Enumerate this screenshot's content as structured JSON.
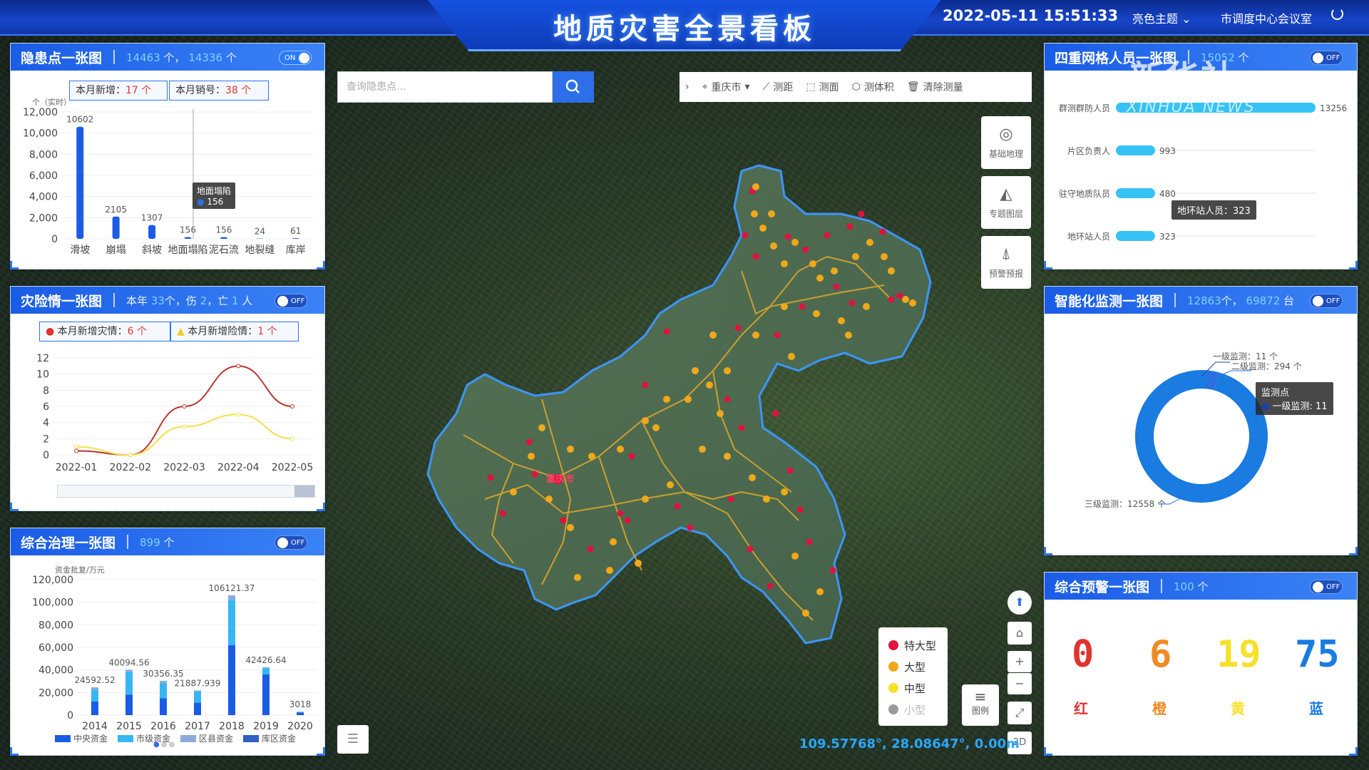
{
  "header": {
    "title": "地质灾害全景看板",
    "datetime": "2022-05-11 15:51:33",
    "theme_label": "亮色主题",
    "room_label": "市调度中心会议室"
  },
  "colors": {
    "primary": "#2e74f0",
    "red": "#e0332f",
    "orange": "#f08a24",
    "yellow": "#f5e12a",
    "blue": "#1a7be0"
  },
  "panel_hazard": {
    "title": "隐患点一张图",
    "stat_total": "14463",
    "unit1": "个，",
    "stat_active": "14336",
    "unit2": "个",
    "toggle": "ON",
    "chip_new_label": "本月新增：",
    "chip_new_value": "17 个",
    "chip_cancel_label": "本月销号：",
    "chip_cancel_value": "38 个",
    "y_unit": "个（实时）",
    "tooltip_title": "地面塌陷",
    "tooltip_value": "156"
  },
  "panel_disaster": {
    "title": "灾险情一张图",
    "stat_prefix": "本年",
    "stat_count": "33",
    "stat_mid": "个，伤",
    "stat_injured": "2",
    "stat_mid2": "，亡",
    "stat_dead": "1",
    "stat_suffix": "人",
    "toggle": "OFF",
    "chip_disaster_label": "本月新增灾情：",
    "chip_disaster_value": "6 个",
    "chip_risk_label": "本月新增险情：",
    "chip_risk_value": "1 个"
  },
  "panel_governance": {
    "title": "综合治理一张图",
    "stat": "899",
    "unit": "个",
    "toggle": "OFF",
    "y_unit": "资金批复/万元"
  },
  "panel_grid": {
    "title": "四重网格人员一张图",
    "stat": "15052",
    "unit": "个",
    "toggle": "OFF",
    "tooltip": "地环站人员：323"
  },
  "panel_monitor": {
    "title": "智能化监测一张图",
    "stat1": "12863",
    "unit1": "个，",
    "stat2": "69872",
    "unit2": "台",
    "toggle": "OFF",
    "tooltip_title": "监测点",
    "tooltip_line": "一级监测: 11"
  },
  "panel_warning": {
    "title": "综合预警一张图",
    "stat": "100",
    "unit": "个",
    "toggle": "OFF",
    "levels": [
      {
        "value": "0",
        "label": "红",
        "color": "#e0332f"
      },
      {
        "value": "6",
        "label": "橙",
        "color": "#f08a24"
      },
      {
        "value": "19",
        "label": "黄",
        "color": "#f5e12a"
      },
      {
        "value": "75",
        "label": "蓝",
        "color": "#1a7be0"
      }
    ]
  },
  "map": {
    "search_placeholder": "查询隐患点...",
    "city": "重庆市",
    "tools": [
      "测距",
      "测面",
      "测体积",
      "清除测量"
    ],
    "side_tools": [
      "基础地理",
      "专题图层",
      "预警预报"
    ],
    "legend": [
      {
        "label": "特大型",
        "color": "#e0123f"
      },
      {
        "label": "大型",
        "color": "#f0a81a"
      },
      {
        "label": "中型",
        "color": "#f5e12a"
      },
      {
        "label": "小型",
        "color": "#9a9a9a"
      }
    ],
    "legend_button": "图例",
    "coords": "109.57768°, 28.08647°, 0.00m",
    "mode_2d": "2D",
    "city_label": "重庆市"
  },
  "watermark": {
    "cn": "新华社",
    "en": "XINHUA NEWS"
  },
  "chart_data": [
    {
      "type": "bar",
      "title": "",
      "categories": [
        "滑坡",
        "崩塌",
        "斜坡",
        "地面塌陷",
        "泥石流",
        "地裂缝",
        "库岸"
      ],
      "values": [
        10602,
        2105,
        1307,
        156,
        156,
        24,
        61
      ],
      "ylim": [
        0,
        12000
      ],
      "yticks": [
        0,
        2000,
        4000,
        6000,
        8000,
        10000,
        12000
      ],
      "ylabel": "个（实时）"
    },
    {
      "type": "line",
      "title": "",
      "x": [
        "2022-01",
        "2022-02",
        "2022-03",
        "2022-04",
        "2022-05"
      ],
      "series": [
        {
          "name": "灾情",
          "color": "#c0322a",
          "values": [
            0.5,
            0,
            6,
            11,
            6
          ]
        },
        {
          "name": "险情",
          "color": "#f0e24a",
          "values": [
            1,
            0,
            3.5,
            5,
            2
          ]
        }
      ],
      "ylim": [
        0,
        12
      ],
      "yticks": [
        0,
        2,
        4,
        6,
        8,
        10,
        12
      ]
    },
    {
      "type": "bar",
      "title": "",
      "categories": [
        "2014",
        "2015",
        "2016",
        "2017",
        "2018",
        "2019",
        "2020"
      ],
      "totals": [
        24592.52,
        40094.56,
        30356.35,
        21887.939,
        106121.37,
        42426.64,
        3018
      ],
      "series": [
        {
          "name": "中央资金",
          "color": "#1a5ce6",
          "values": [
            12000,
            18000,
            15000,
            11000,
            62000,
            36000,
            2400
          ]
        },
        {
          "name": "市级资金",
          "color": "#36b6f5",
          "values": [
            10592.52,
            20094.56,
            13356.35,
            9887.939,
            40121.37,
            5426.64,
            500
          ]
        },
        {
          "name": "区县资金",
          "color": "#8eaadc",
          "values": [
            2000,
            2000,
            2000,
            1000,
            4000,
            1000,
            118
          ]
        },
        {
          "name": "库区资金",
          "color": "#2f5fc8",
          "values": [
            0,
            0,
            0,
            0,
            0,
            0,
            0
          ]
        }
      ],
      "ylim": [
        0,
        120000
      ],
      "yticks": [
        0,
        20000,
        40000,
        60000,
        80000,
        100000,
        120000
      ],
      "ylabel": "资金批复/万元"
    },
    {
      "type": "bar",
      "title": "",
      "orientation": "horizontal",
      "categories": [
        "群测群防人员",
        "片区负责人",
        "驻守地质队员",
        "地环站人员"
      ],
      "values": [
        13256,
        993,
        480,
        323
      ]
    },
    {
      "type": "pie",
      "title": "",
      "donut": true,
      "slices": [
        {
          "label": "一级监测",
          "value": 11,
          "color": "#1a3fa8"
        },
        {
          "label": "二级监测",
          "value": 294,
          "color": "#2a6ee0"
        },
        {
          "label": "三级监测",
          "value": 12558,
          "color": "#1a7be0"
        }
      ]
    }
  ]
}
